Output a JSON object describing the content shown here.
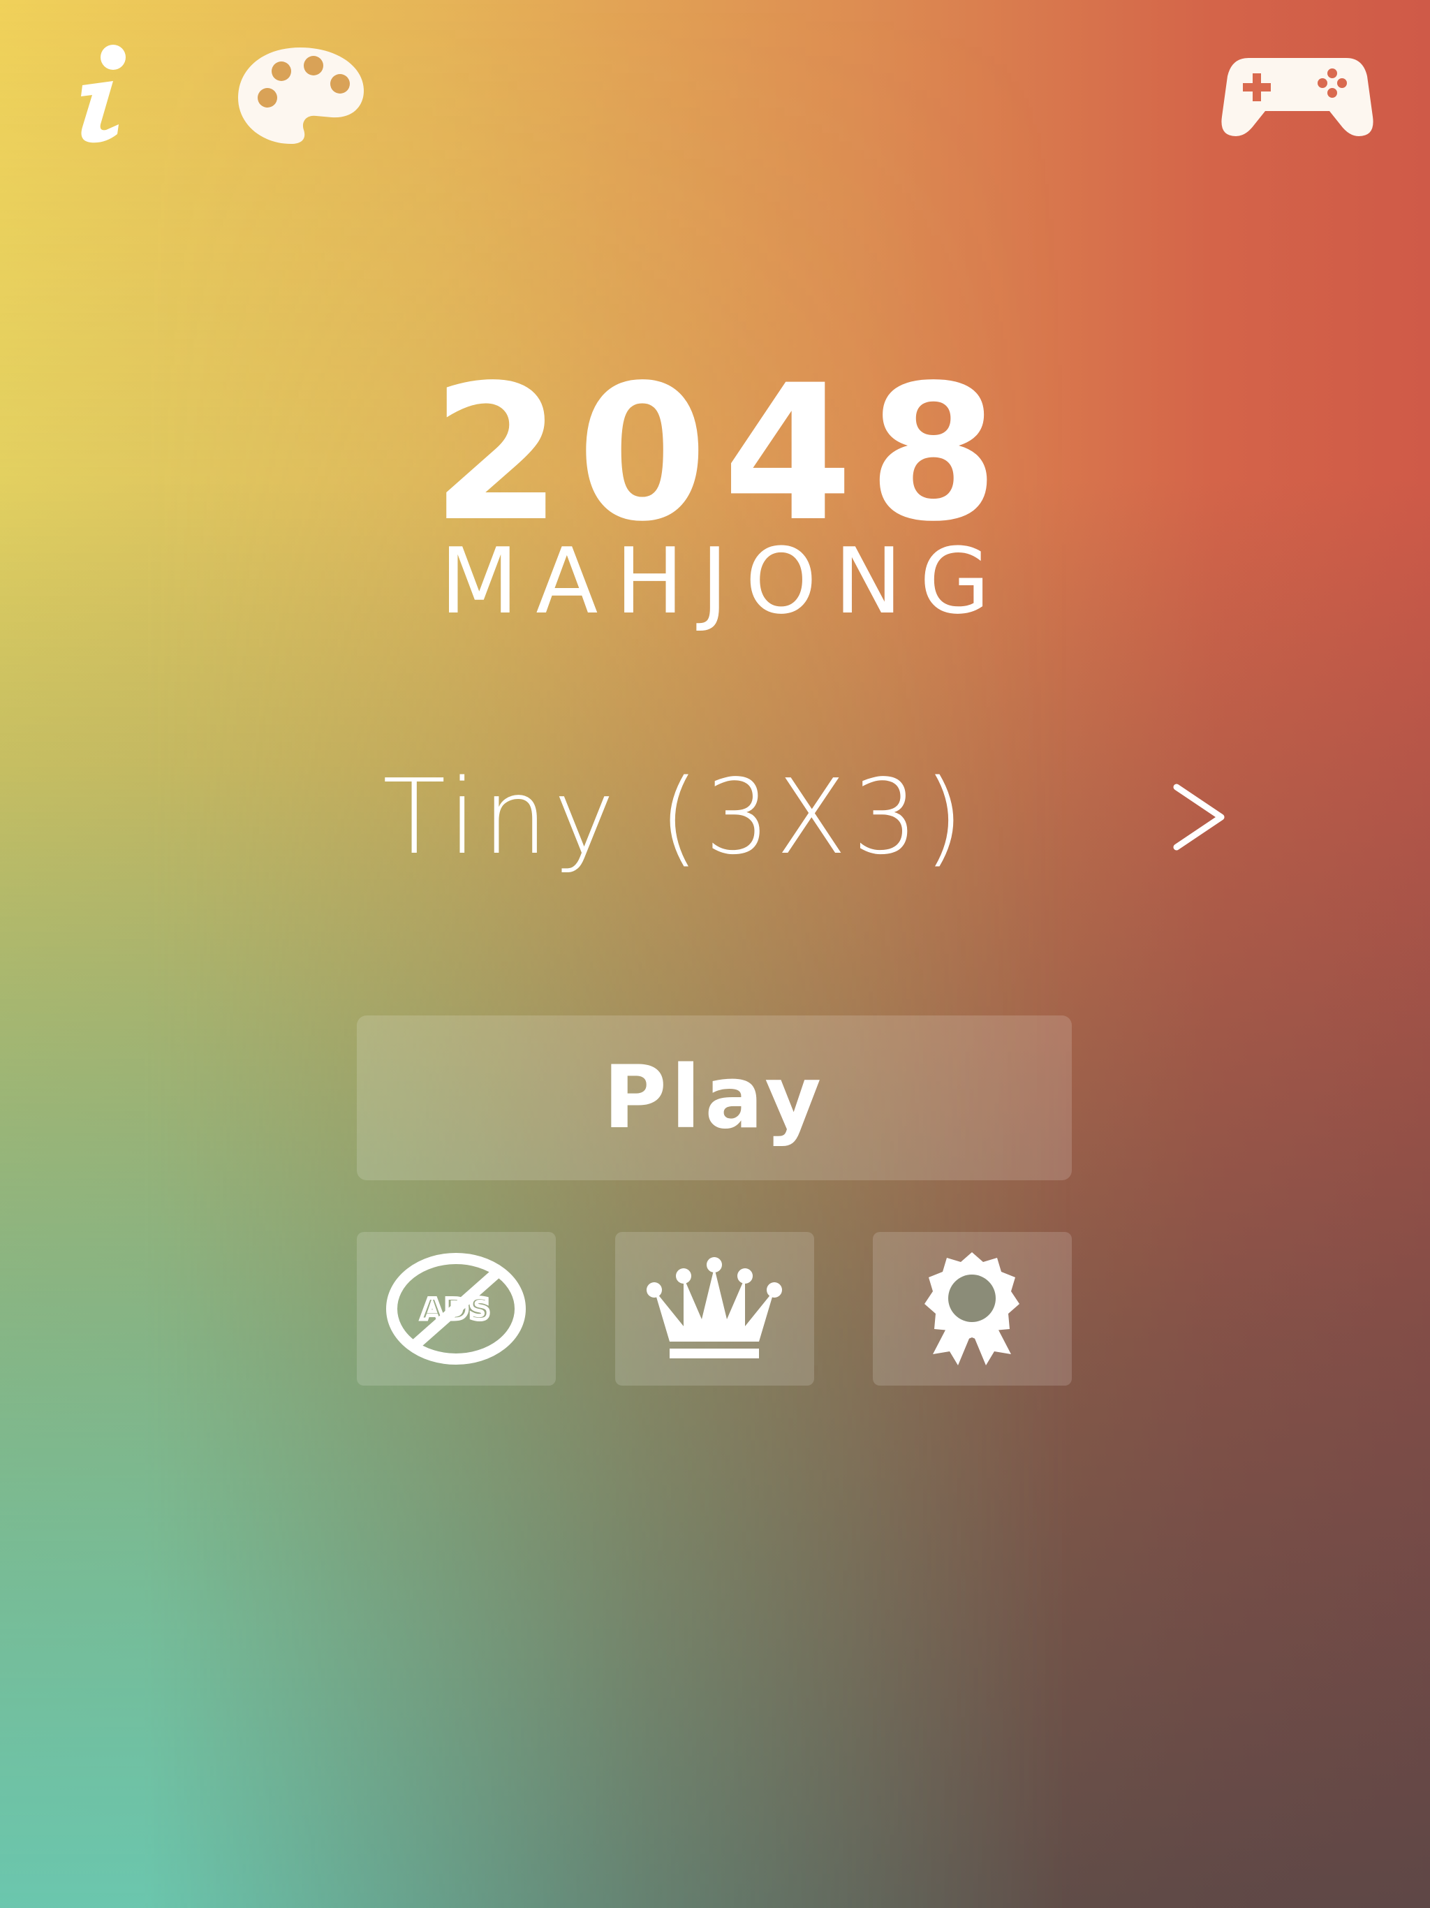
{
  "title": {
    "main": "2048",
    "sub": "MAHJONG"
  },
  "board_size": {
    "label": "Tiny (3X3)",
    "next_icon": "chevron-right-icon"
  },
  "buttons": {
    "play_label": "Play",
    "remove_ads_icon": "no-ads-icon",
    "leaderboard_icon": "crown-icon",
    "achievements_icon": "award-ribbon-icon"
  },
  "top_bar": {
    "info_icon": "info-icon",
    "theme_icon": "palette-icon",
    "game_services_icon": "gamepad-icon"
  },
  "colors": {
    "text": "#ffffff",
    "gradient_top_left": "#f0d15a",
    "gradient_top_right": "#cf5a48",
    "gradient_bottom_left": "#6cd2b9",
    "gradient_bottom_right": "#464648"
  }
}
